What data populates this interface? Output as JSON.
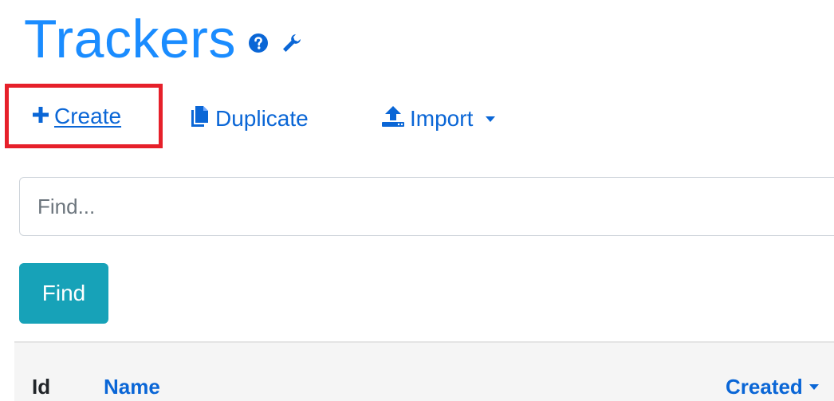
{
  "header": {
    "title": "Trackers",
    "help_icon": "question-circle-icon",
    "settings_icon": "wrench-icon"
  },
  "toolbar": {
    "create_label": "Create",
    "duplicate_label": "Duplicate",
    "import_label": "Import",
    "icons": {
      "create": "plus-icon",
      "duplicate": "copy-icon",
      "import": "upload-icon"
    }
  },
  "search": {
    "placeholder": "Find...",
    "value": "",
    "button_label": "Find"
  },
  "table": {
    "columns": [
      "Id",
      "Name",
      "Created"
    ]
  },
  "colors": {
    "title": "#1a8cff",
    "link": "#0a66d6",
    "find_button": "#17a2b8",
    "highlight": "#e6202a"
  }
}
